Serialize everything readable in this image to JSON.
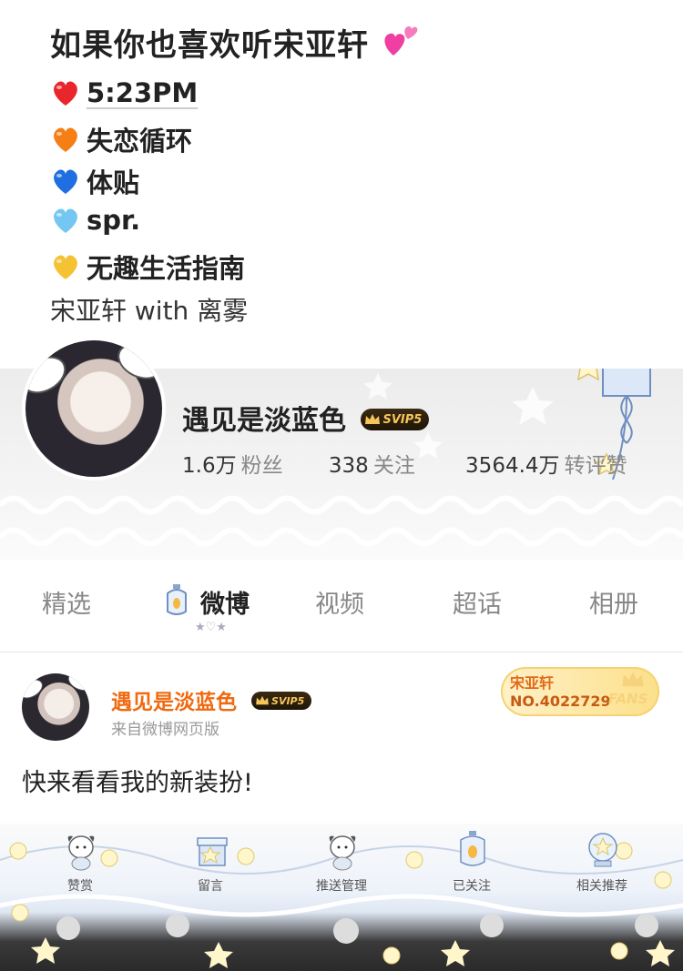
{
  "intro": {
    "heading": "如果你也喜欢听宋亚轩",
    "songs": [
      {
        "text": "5:23PM",
        "heart_color": "#e8262b"
      },
      {
        "text": "失恋循环",
        "heart_color": "#f57e15"
      },
      {
        "text": "体贴",
        "heart_color": "#1f6fe0"
      },
      {
        "text": "spr.",
        "heart_color": "#73c7f2"
      },
      {
        "text": "无趣生活指南",
        "heart_color": "#f5c233"
      }
    ],
    "sub": "宋亚轩 with 离雾",
    "sparkle_color": "#ef3fa0"
  },
  "profile": {
    "name": "遇见是淡蓝色",
    "badge": "SVIP5",
    "fans_num": "1.6万",
    "fans_lbl": "粉丝",
    "follow_num": "338",
    "follow_lbl": "关注",
    "likes_num": "3564.4万",
    "likes_lbl": "转评赞"
  },
  "tabs": [
    {
      "label": "精选",
      "active": false
    },
    {
      "label": "微博",
      "active": true
    },
    {
      "label": "视频",
      "active": false
    },
    {
      "label": "超话",
      "active": false
    },
    {
      "label": "相册",
      "active": false
    }
  ],
  "post": {
    "user": "遇见是淡蓝色",
    "badge": "SVIP5",
    "source": "来自微博网页版",
    "fan_title": "宋亚轩",
    "fan_no": "NO.4022729",
    "fan_word": "FANS",
    "text": "快来看看我的新装扮!"
  },
  "toolbar": [
    {
      "label": "赞赏",
      "icon": "puppy-icon"
    },
    {
      "label": "留言",
      "icon": "gift-box-icon"
    },
    {
      "label": "推送管理",
      "icon": "puppy-icon"
    },
    {
      "label": "已关注",
      "icon": "lantern-icon"
    },
    {
      "label": "相关推荐",
      "icon": "star-globe-icon"
    }
  ],
  "accent": "#f06a10"
}
